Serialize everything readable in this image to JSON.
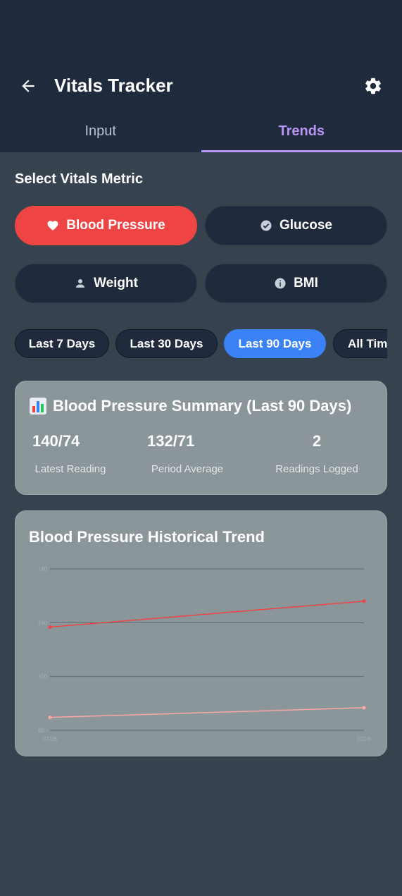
{
  "app": {
    "title": "Vitals Tracker",
    "back_icon": "arrow-left-icon",
    "settings_icon": "gear-icon"
  },
  "tabs": [
    {
      "label": "Input",
      "active": false
    },
    {
      "label": "Trends",
      "active": true
    }
  ],
  "metric_section": {
    "title": "Select Vitals Metric",
    "metrics": [
      {
        "label": "Blood Pressure",
        "icon": "heart-icon",
        "selected": true
      },
      {
        "label": "Glucose",
        "icon": "check-circle-icon",
        "selected": false
      },
      {
        "label": "Weight",
        "icon": "person-icon",
        "selected": false
      },
      {
        "label": "BMI",
        "icon": "info-icon",
        "selected": false
      }
    ]
  },
  "ranges": [
    {
      "label": "Last 7 Days",
      "selected": false
    },
    {
      "label": "Last 30 Days",
      "selected": false
    },
    {
      "label": "Last 90 Days",
      "selected": true
    },
    {
      "label": "All Time",
      "selected": false
    }
  ],
  "summary": {
    "icon": "bar-chart-icon",
    "title": "Blood Pressure Summary (Last 90 Days)",
    "stats": [
      {
        "value": "140/74",
        "label": "Latest Reading"
      },
      {
        "value": "132/71",
        "label": "Period Average"
      },
      {
        "value": "2",
        "label": "Readings Logged"
      }
    ]
  },
  "trend": {
    "title": "Blood Pressure Historical Trend"
  },
  "colors": {
    "accent_purple": "#b794f6",
    "selected_red": "#ef4444",
    "selected_blue": "#3b82f6",
    "systolic_line": "#ef4444",
    "diastolic_line": "#fca5a5"
  },
  "chart_data": {
    "type": "line",
    "x": [
      "07/26",
      "07/28"
    ],
    "y_ticks": [
      "80",
      "100",
      "140",
      "180"
    ],
    "ylim": [
      60,
      160
    ],
    "grid": true,
    "series": [
      {
        "values": [
          124,
          140
        ]
      },
      {
        "values": [
          68,
          74
        ]
      }
    ]
  }
}
